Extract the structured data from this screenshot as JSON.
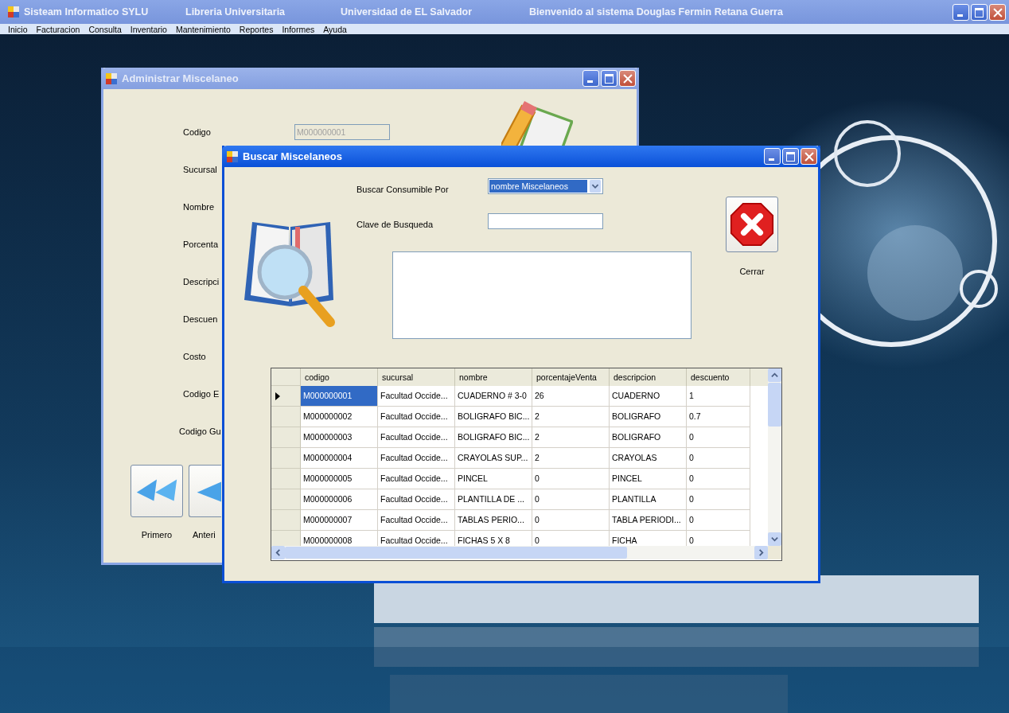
{
  "window": {
    "title_parts": [
      "Sisteam Informatico SYLU",
      "Libreria Universitaria",
      "Universidad de EL Salvador",
      "Bienvenido al sistema Douglas Fermin Retana Guerra"
    ]
  },
  "menu": [
    "Inicio",
    "Facturacion",
    "Consulta",
    "Inventario",
    "Mantenimiento",
    "Reportes",
    "Informes",
    "Ayuda"
  ],
  "admin_window": {
    "title": "Administrar Miscelaneo",
    "fields": [
      {
        "label": "Codigo",
        "value": "M000000001",
        "disabled": true
      },
      {
        "label": "Sucursal"
      },
      {
        "label": "Nombre"
      },
      {
        "label": "Porcenta"
      },
      {
        "label": "Descripci"
      },
      {
        "label": "Descuen"
      },
      {
        "label": "Costo"
      },
      {
        "label": "Codigo E"
      },
      {
        "label": "Codigo Gu"
      }
    ],
    "nav_buttons": [
      {
        "label": "Primero",
        "kind": "first"
      },
      {
        "label": "Anteri",
        "kind": "previous"
      }
    ]
  },
  "search_window": {
    "title": "Buscar Miscelaneos",
    "search_by": {
      "label": "Buscar Consumible Por",
      "value": "nombre Miscelaneos"
    },
    "search_key": {
      "label": "Clave de Busqueda"
    },
    "close_button": {
      "label": "Cerrar"
    },
    "grid": {
      "columns": [
        "codigo",
        "sucursal",
        "nombre",
        "porcentajeVenta",
        "descripcion",
        "descuento"
      ],
      "rows": [
        {
          "selected": true,
          "cells": [
            "M000000001",
            "Facultad Occide...",
            "CUADERNO # 3-0",
            "26",
            "CUADERNO",
            "1"
          ]
        },
        {
          "selected": false,
          "cells": [
            "M000000002",
            "Facultad Occide...",
            "BOLIGRAFO BIC...",
            "2",
            "BOLIGRAFO",
            "0.7"
          ]
        },
        {
          "selected": false,
          "cells": [
            "M000000003",
            "Facultad Occide...",
            "BOLIGRAFO BIC...",
            "2",
            "BOLIGRAFO",
            "0"
          ]
        },
        {
          "selected": false,
          "cells": [
            "M000000004",
            "Facultad Occide...",
            "CRAYOLAS SUP...",
            "2",
            "CRAYOLAS",
            "0"
          ]
        },
        {
          "selected": false,
          "cells": [
            "M000000005",
            "Facultad Occide...",
            "PINCEL",
            "0",
            "PINCEL",
            "0"
          ]
        },
        {
          "selected": false,
          "cells": [
            "M000000006",
            "Facultad Occide...",
            "PLANTILLA DE ...",
            "0",
            "PLANTILLA",
            "0"
          ]
        },
        {
          "selected": false,
          "cells": [
            "M000000007",
            "Facultad Occide...",
            "TABLAS PERIO...",
            "0",
            "TABLA PERIODI...",
            "0"
          ]
        },
        {
          "selected": false,
          "cells": [
            "M000000008",
            "Facultad Occide...",
            "FICHAS 5 X 8",
            "0",
            "FICHA",
            "0"
          ]
        }
      ]
    }
  }
}
